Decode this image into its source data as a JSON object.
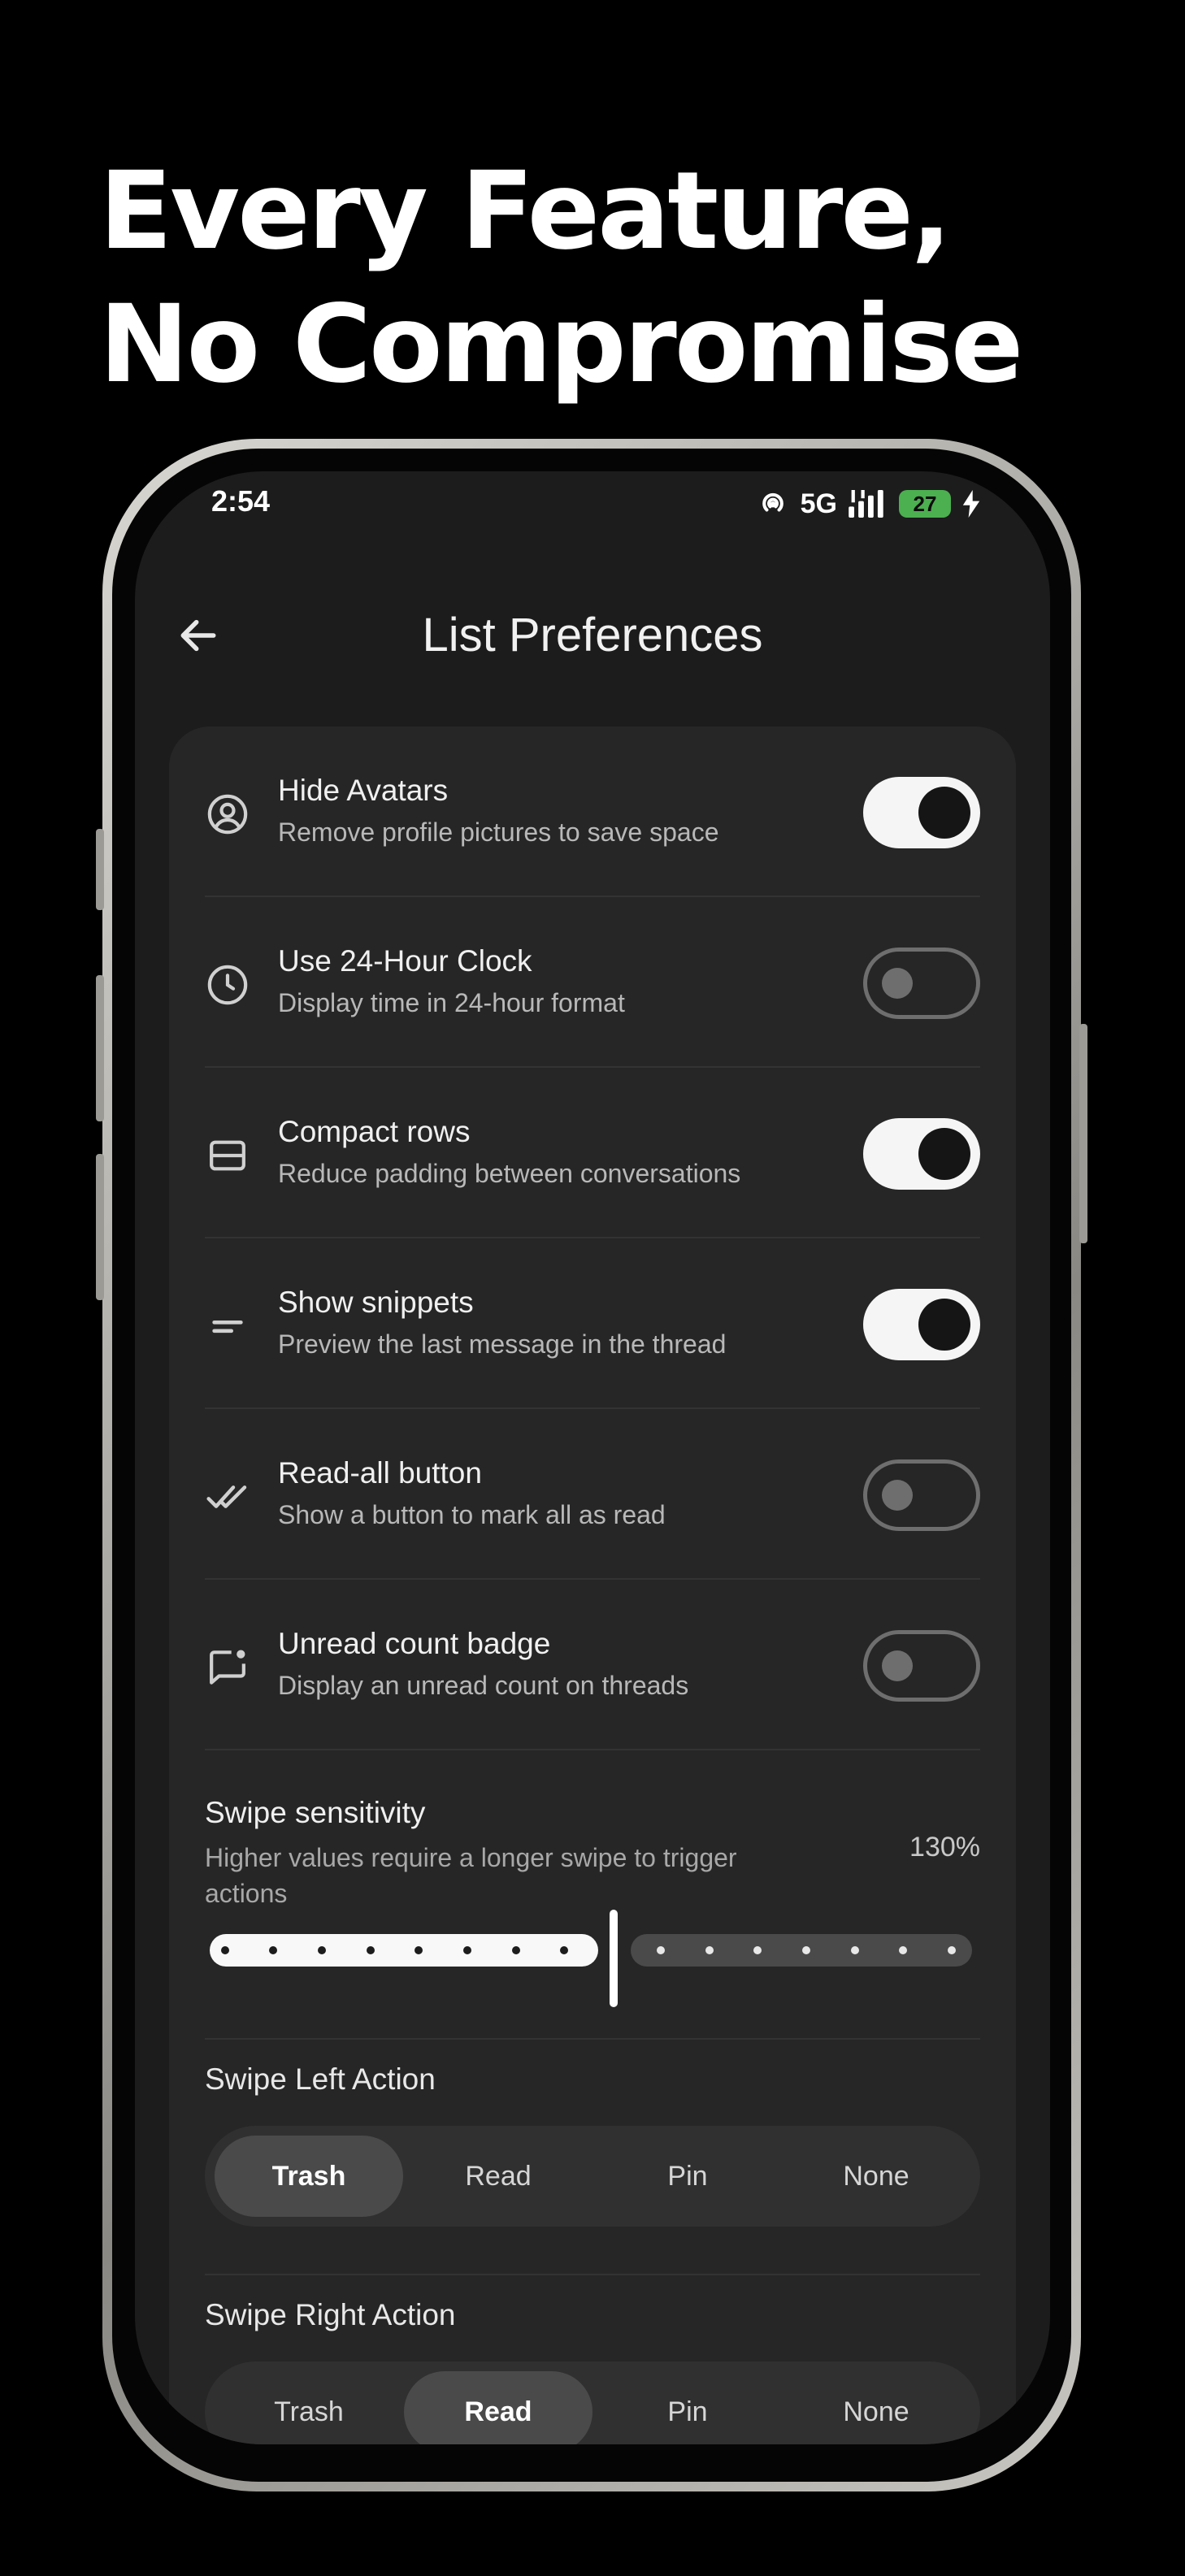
{
  "headline": {
    "line1": "Every Feature,",
    "line2": "No Compromise"
  },
  "status_bar": {
    "time": "2:54",
    "network": "5G",
    "battery": "27"
  },
  "app_bar": {
    "title": "List Preferences"
  },
  "settings": [
    {
      "title": "Hide Avatars",
      "subtitle": "Remove profile pictures to save space",
      "icon": "avatar-icon",
      "enabled": true
    },
    {
      "title": "Use 24-Hour Clock",
      "subtitle": "Display time in 24-hour format",
      "icon": "clock-icon",
      "enabled": false
    },
    {
      "title": "Compact rows",
      "subtitle": "Reduce padding between conversations",
      "icon": "compact-rows-icon",
      "enabled": true
    },
    {
      "title": "Show snippets",
      "subtitle": "Preview the last message in the thread",
      "icon": "snippet-icon",
      "enabled": true
    },
    {
      "title": "Read-all button",
      "subtitle": "Show a button to mark all as read",
      "icon": "double-check-icon",
      "enabled": false
    },
    {
      "title": "Unread count badge",
      "subtitle": "Display an unread count on threads",
      "icon": "chat-badge-icon",
      "enabled": false
    }
  ],
  "swipe_sensitivity": {
    "title": "Swipe sensitivity",
    "subtitle": "Higher values require a longer swipe to trigger actions",
    "value_label": "130%",
    "value_fraction": 0.49
  },
  "swipe_left": {
    "label": "Swipe Left Action",
    "options": [
      "Trash",
      "Read",
      "Pin",
      "None"
    ],
    "selected": "Trash"
  },
  "swipe_right": {
    "label": "Swipe Right Action",
    "options": [
      "Trash",
      "Read",
      "Pin",
      "None"
    ],
    "selected": "Read"
  },
  "colors": {
    "background": "#000000",
    "screen": "#1c1c1c",
    "card": "#262626",
    "toggle_on": "#f5f5f5",
    "battery": "#4caf50"
  }
}
